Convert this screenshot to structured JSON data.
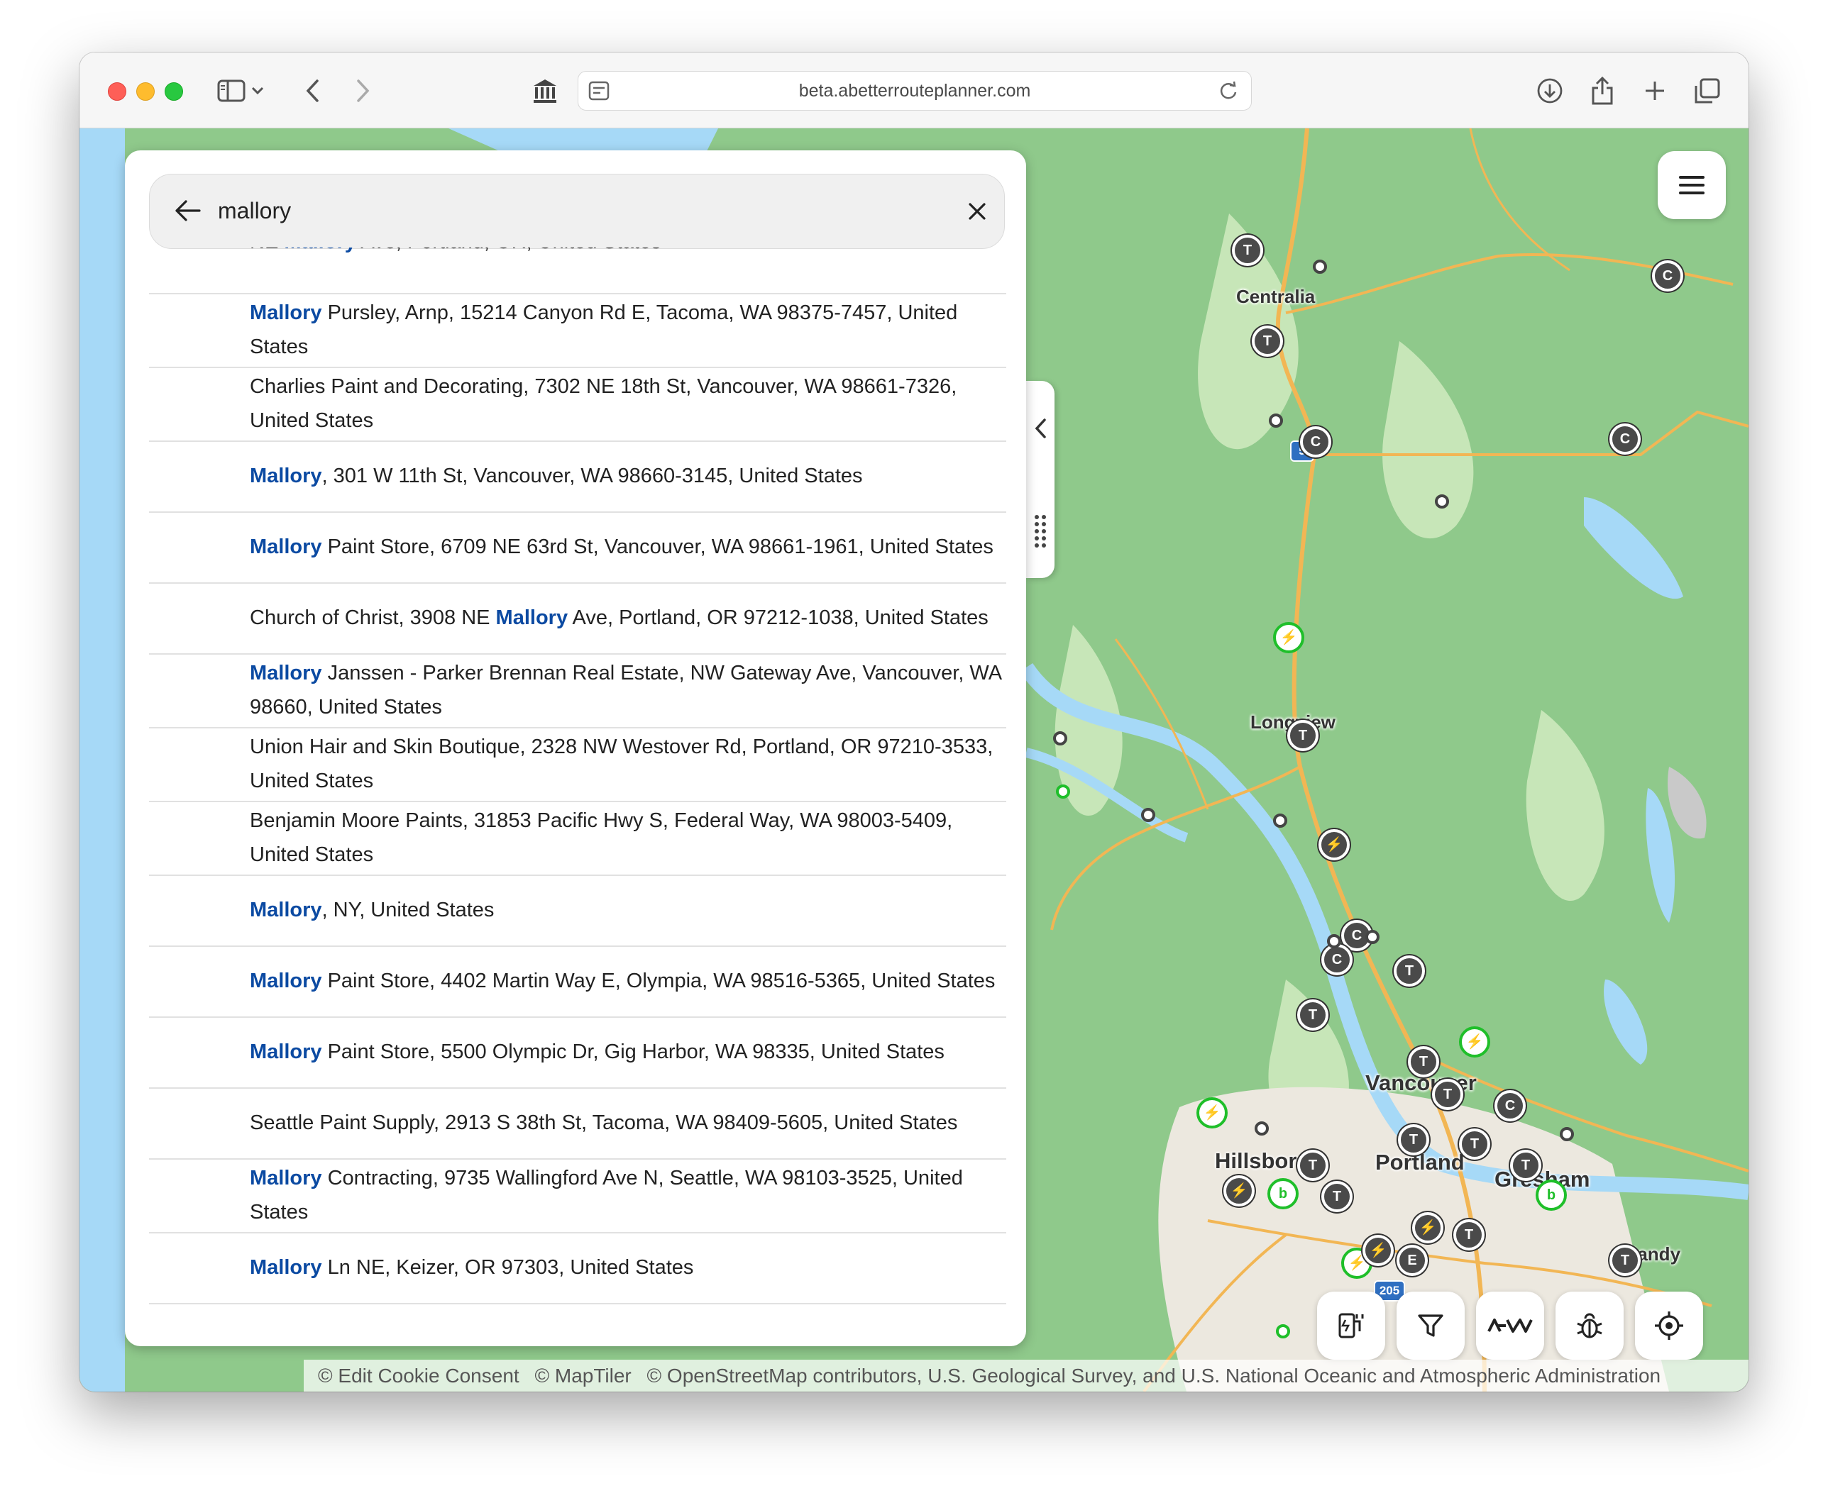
{
  "browser": {
    "url": "beta.abetterrouteplanner.com"
  },
  "search": {
    "query": "mallory",
    "partial_top_result": {
      "pre": "NE ",
      "hl": "Mallory",
      "post": " Ave, Portland, OR, United States"
    },
    "results": [
      {
        "hl": "Mallory",
        "rest": " Pursley, Arnp, 15214 Canyon Rd E, Tacoma, WA 98375-7457, United States"
      },
      {
        "hl": "",
        "rest": "Charlies Paint and Decorating, 7302 NE 18th St, Vancouver, WA 98661-7326, United States"
      },
      {
        "hl": "Mallory",
        "rest": ", 301 W 11th St, Vancouver, WA 98660-3145, United States"
      },
      {
        "hl": "Mallory",
        "rest": " Paint Store, 6709 NE 63rd St, Vancouver, WA 98661-1961, United States"
      },
      {
        "pre": "Church of Christ, 3908 NE ",
        "hl": "Mallory",
        "rest": " Ave, Portland, OR 97212-1038, United States"
      },
      {
        "hl": "Mallory",
        "rest": " Janssen - Parker Brennan Real Estate, NW Gateway Ave, Vancouver, WA 98660, United States"
      },
      {
        "hl": "",
        "rest": "Union Hair and Skin Boutique, 2328 NW Westover Rd, Portland, OR 97210-3533, United States"
      },
      {
        "hl": "",
        "rest": "Benjamin Moore Paints, 31853 Pacific Hwy S, Federal Way, WA 98003-5409, United States"
      },
      {
        "hl": "Mallory",
        "rest": ", NY, United States"
      },
      {
        "hl": "Mallory",
        "rest": " Paint Store, 4402 Martin Way E, Olympia, WA 98516-5365, United States"
      },
      {
        "hl": "Mallory",
        "rest": " Paint Store, 5500 Olympic Dr, Gig Harbor, WA 98335, United States"
      },
      {
        "hl": "",
        "rest": "Seattle Paint Supply, 2913 S 38th St, Tacoma, WA 98409-5605, United States"
      },
      {
        "hl": "Mallory",
        "rest": " Contracting, 9735 Wallingford Ave N, Seattle, WA 98103-3525, United States"
      },
      {
        "hl": "Mallory",
        "rest": " Ln NE, Keizer, OR 97303, United States"
      }
    ]
  },
  "map": {
    "cities": {
      "centralia": "Centralia",
      "longview": "Longview",
      "vancouver": "Vancouver",
      "portland": "Portland",
      "hillsboro": "Hillsboro",
      "gresham": "Gresham",
      "sandy": "Sandy"
    },
    "highway_shields": {
      "i5": "5",
      "i205": "205"
    },
    "attribution": {
      "cookie": "© Edit Cookie Consent",
      "maptiler": "© MapTiler",
      "osm": "© OpenStreetMap contributors, U.S. Geological Survey, and U.S. National Oceanic and Atmospheric Administration"
    },
    "bottom_buttons": [
      "charger-filter-icon",
      "filter-icon",
      "kia-logo-icon",
      "bug-icon",
      "locate-icon"
    ]
  },
  "colors": {
    "water": "#a6d9f7",
    "forest": "#8fc98b",
    "highlight": "#0b4aa2",
    "charger_green": "#1fbf2a"
  }
}
